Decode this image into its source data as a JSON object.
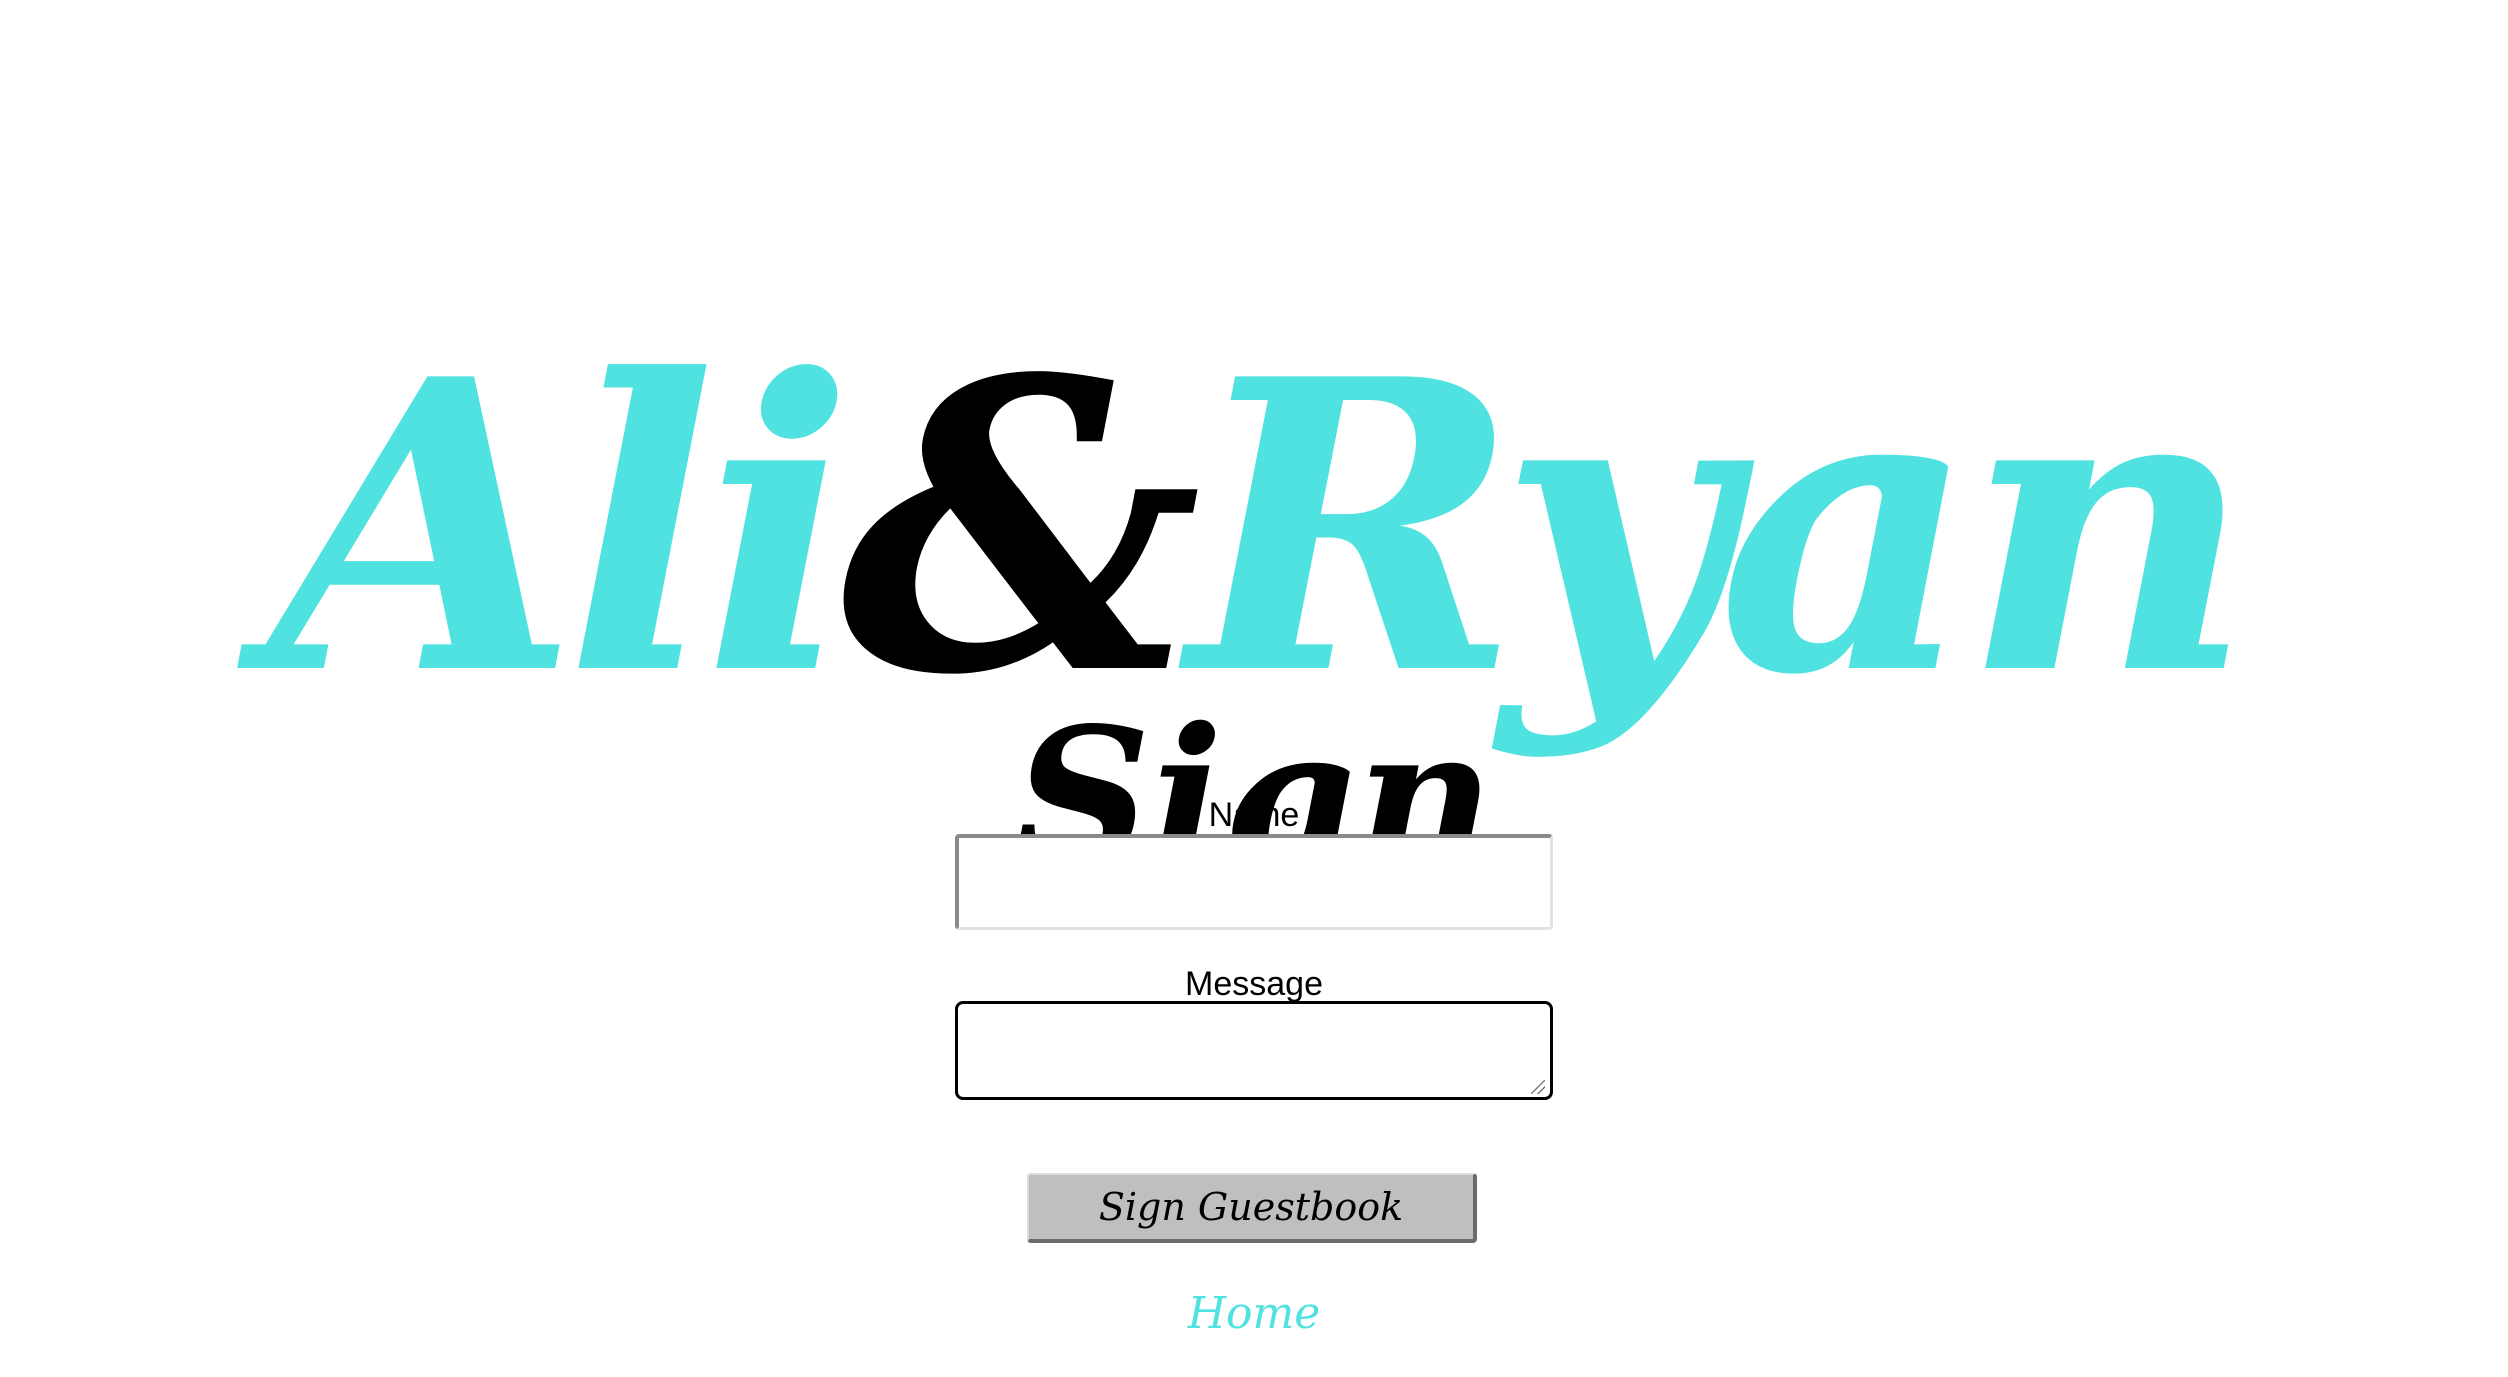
{
  "header": {
    "name_first": "Ali",
    "ampersand": "&",
    "name_second": "Ryan"
  },
  "page": {
    "title": "Sign"
  },
  "form": {
    "name_label": "Name",
    "name_value": "",
    "message_label": "Message",
    "message_value": "",
    "submit_label": "Sign Guestbook"
  },
  "nav": {
    "home_label": "Home"
  },
  "colors": {
    "accent": "#4fe2e0",
    "text": "#000000",
    "button_bg": "#bfbfbf",
    "background": "#ffffff"
  }
}
